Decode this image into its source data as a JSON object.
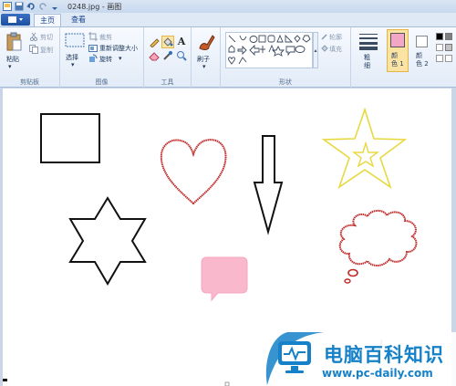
{
  "window": {
    "title": "0248.jpg - 画图"
  },
  "tabs": [
    {
      "label": "主页"
    },
    {
      "label": "查看"
    }
  ],
  "clipboard": {
    "paste": "粘贴",
    "cut": "剪切",
    "copy": "复制",
    "group": "剪贴板"
  },
  "image": {
    "select": "选择",
    "crop": "裁剪",
    "resize": "重新调整大小",
    "rotate": "旋转",
    "group": "图像"
  },
  "tools": {
    "group": "工具"
  },
  "brushes": {
    "label": "刷子"
  },
  "shapes": {
    "outline": "轮廓",
    "fill": "填充",
    "group": "形状"
  },
  "size": {
    "label": "粗\n细"
  },
  "colors": {
    "color1": "颜\n色 1",
    "color2": "颜\n色 2",
    "color1_value": "#f4a6c6",
    "color2_value": "#ffffff"
  },
  "watermark": {
    "title": "电脑百科知识",
    "url": "www.pc-daily.com"
  }
}
